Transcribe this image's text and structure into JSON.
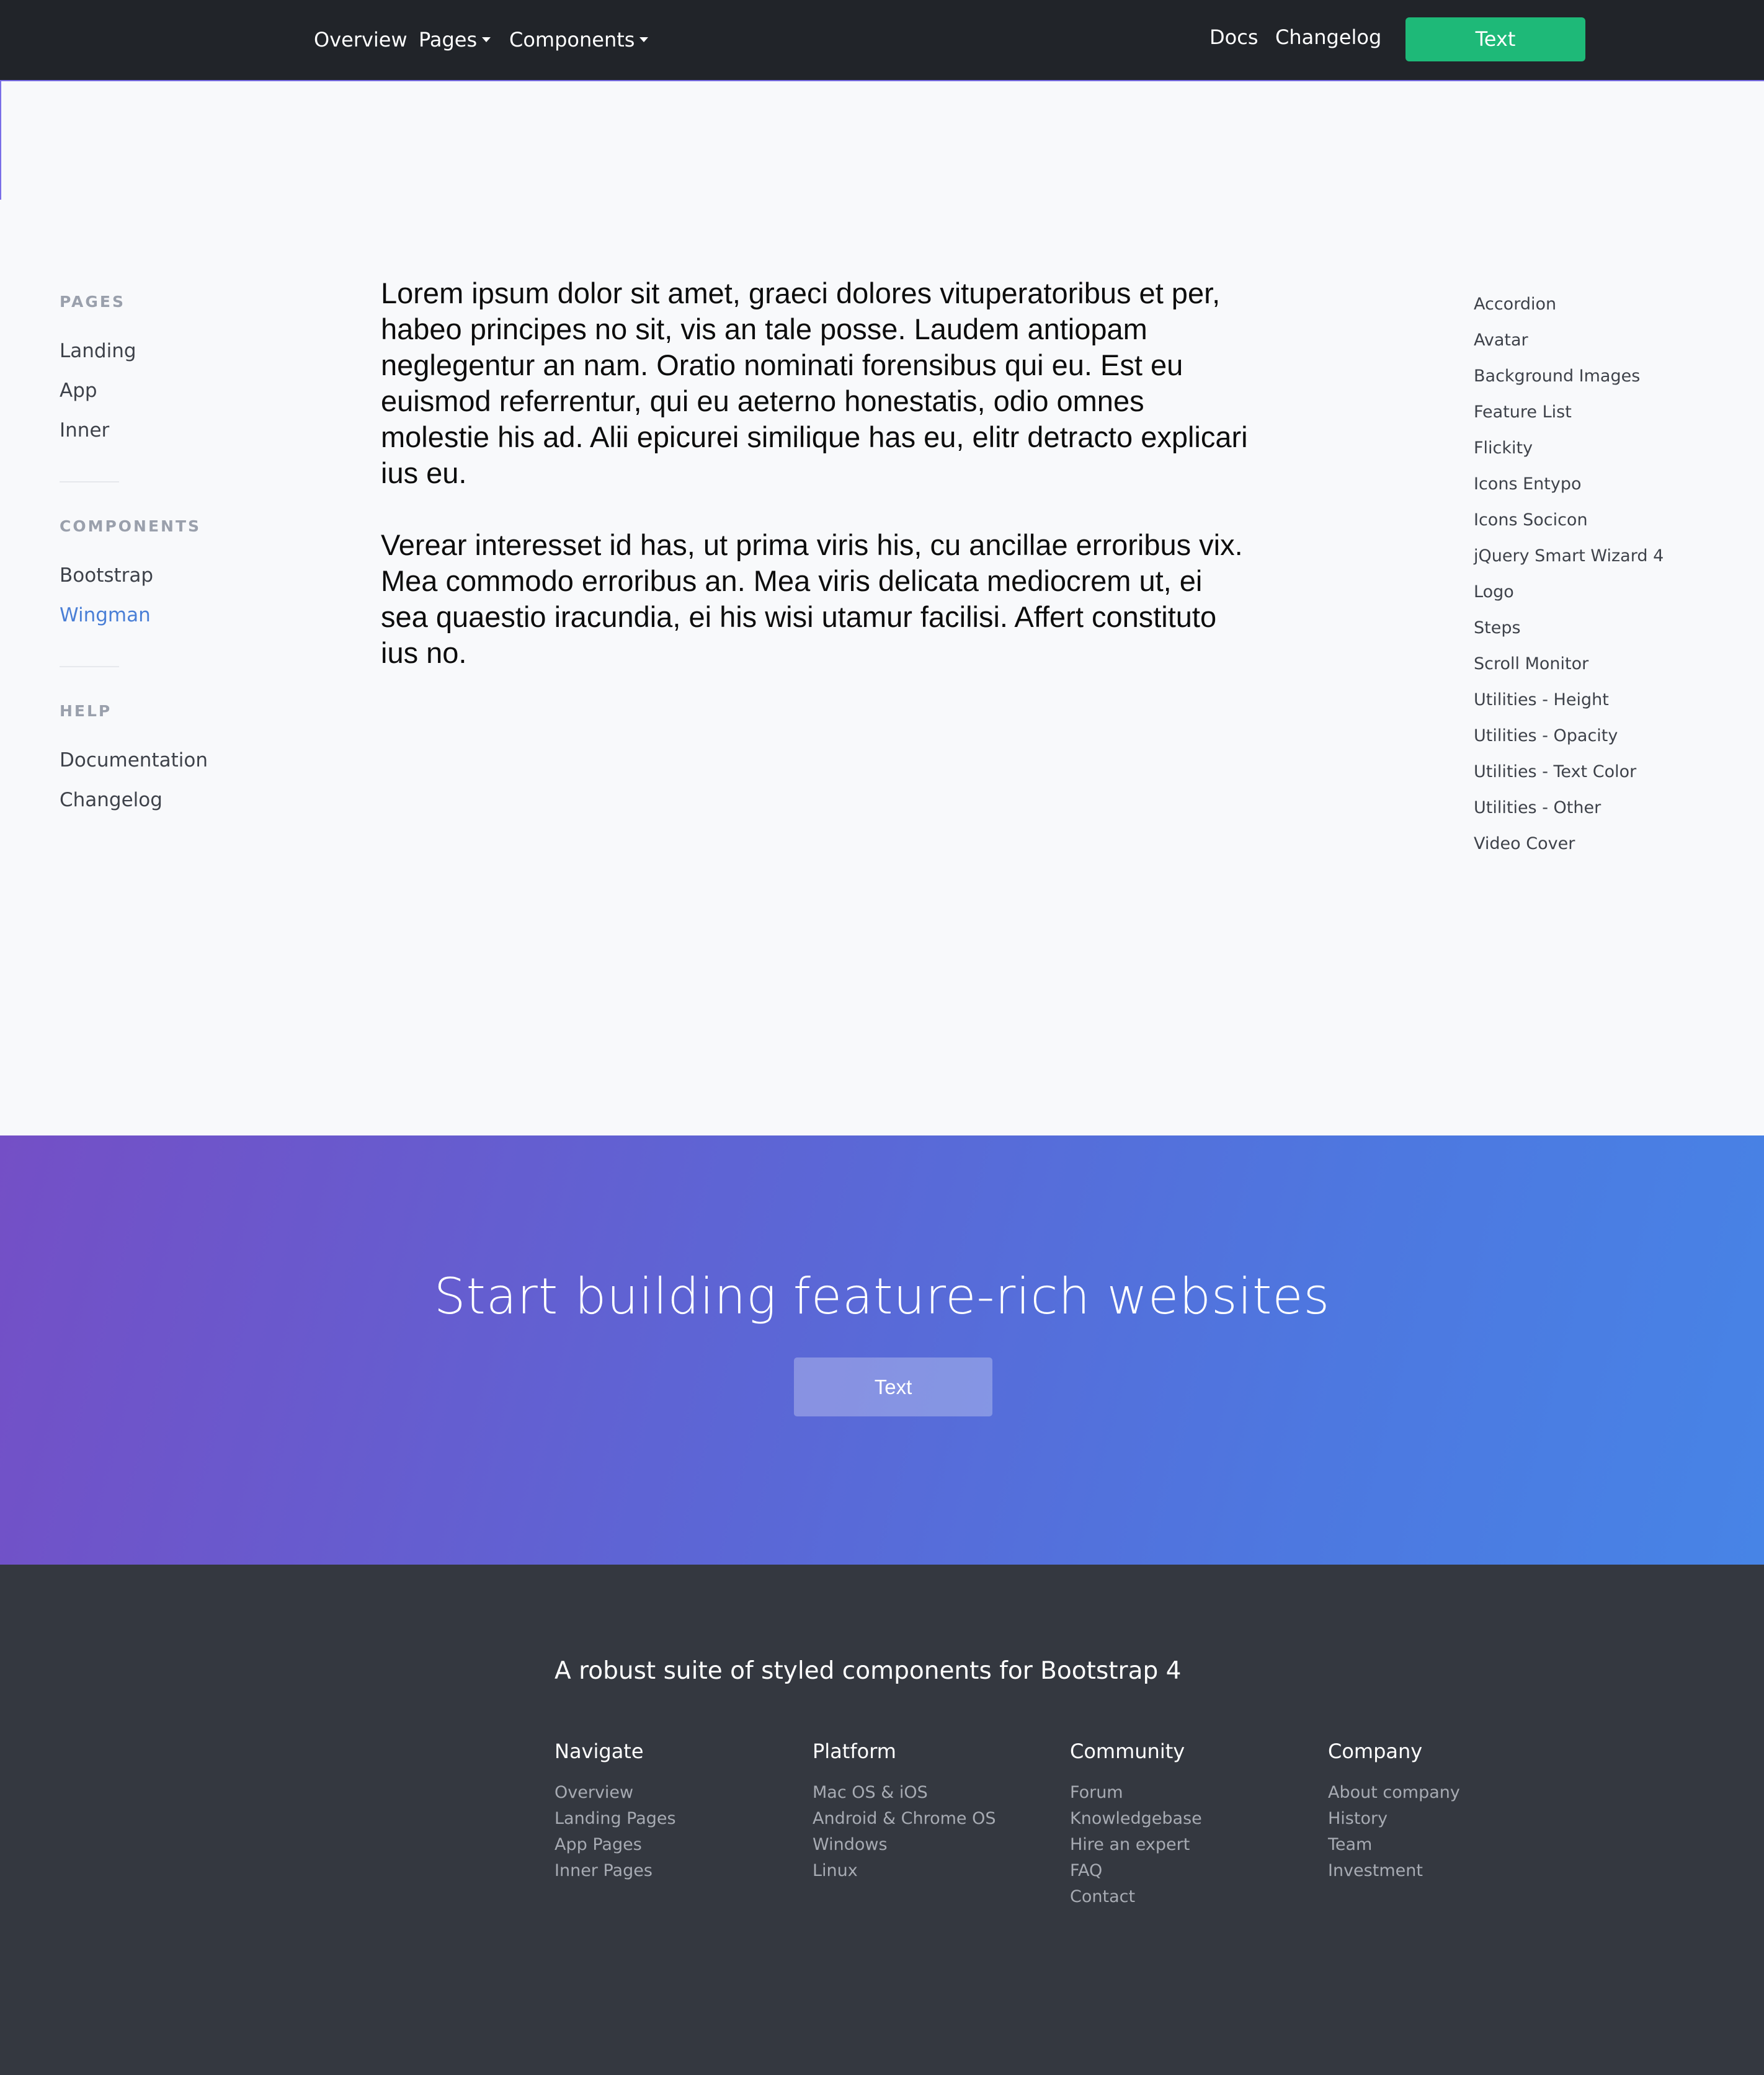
{
  "navbar": {
    "links": [
      "Overview",
      "Pages",
      "Components"
    ],
    "right_links": [
      "Docs",
      "Changelog"
    ],
    "cta_label": "Text",
    "colors": {
      "background": "#212429",
      "cta": "#1eb978"
    }
  },
  "sidebar": {
    "sections": [
      {
        "heading": "PAGES",
        "items": [
          "Landing",
          "App",
          "Inner"
        ]
      },
      {
        "heading": "COMPONENTS",
        "items": [
          "Bootstrap",
          "Wingman"
        ]
      },
      {
        "heading": "HELP",
        "items": [
          "Documentation",
          "Changelog"
        ]
      }
    ],
    "active_item": "Wingman",
    "active_color": "#4a7fd6"
  },
  "main": {
    "paragraphs": [
      "Lorem ipsum dolor sit amet, graeci dolores vituperatoribus et per, habeo principes no sit, vis an tale posse. Laudem antiopam neglegentur an nam. Oratio nominati forensibus qui eu. Est eu euismod referrentur, qui eu aeterno honestatis, odio omnes molestie his ad. Alii epicurei similique has eu, elitr detracto explicari ius eu.",
      "Verear interesset id has, ut prima viris his, cu ancillae erroribus vix. Mea commodo erroribus an. Mea viris delicata mediocrem ut, ei sea quaestio iracundia, ei his wisi utamur facilisi. Affert constituto ius no."
    ]
  },
  "right_nav": {
    "items": [
      "Accordion",
      "Avatar",
      "Background Images",
      "Feature List",
      "Flickity",
      "Icons Entypo",
      "Icons Socicon",
      "jQuery Smart Wizard 4",
      "Logo",
      "Steps",
      "Scroll Monitor",
      "Utilities - Height",
      "Utilities - Opacity",
      "Utilities - Text Color",
      "Utilities - Other",
      "Video Cover"
    ]
  },
  "cta": {
    "title": "Start building feature-rich websites",
    "button_label": "Text",
    "gradient": [
      "#744fc6",
      "#4784e6"
    ]
  },
  "footer": {
    "tagline": "A robust suite of styled components for Bootstrap 4",
    "columns": [
      {
        "title": "Navigate",
        "links": [
          "Overview",
          "Landing Pages",
          "App Pages",
          "Inner Pages"
        ]
      },
      {
        "title": "Platform",
        "links": [
          "Mac OS & iOS",
          "Android & Chrome OS",
          "Windows",
          "Linux"
        ]
      },
      {
        "title": "Community",
        "links": [
          "Forum",
          "Knowledgebase",
          "Hire an expert",
          "FAQ",
          "Contact"
        ]
      },
      {
        "title": "Company",
        "links": [
          "About company",
          "History",
          "Team",
          "Investment"
        ]
      }
    ],
    "background": "#343840"
  }
}
